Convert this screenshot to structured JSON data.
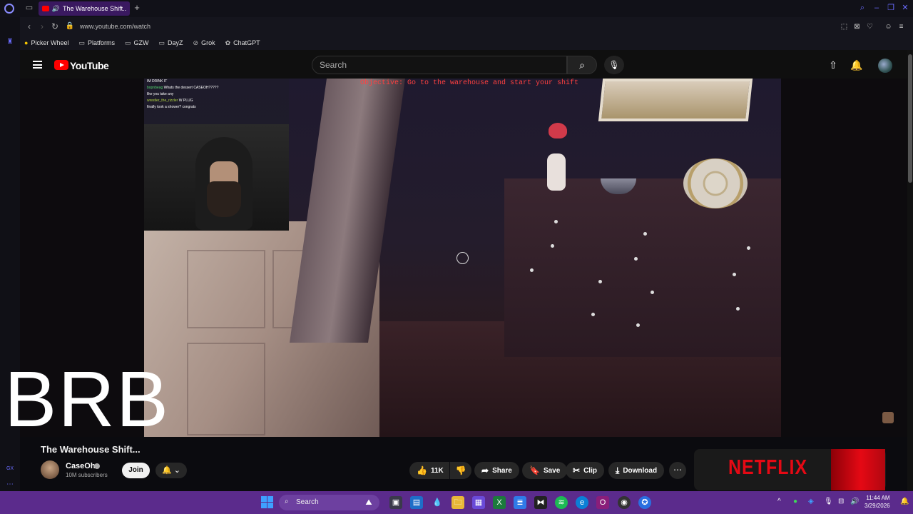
{
  "browser": {
    "tab_title": "The Warehouse Shift...",
    "url": "www.youtube.com/watch",
    "bookmarks": [
      {
        "label": "Picker Wheel",
        "icon": "wheel-icon"
      },
      {
        "label": "Platforms",
        "icon": "folder-icon"
      },
      {
        "label": "GZW",
        "icon": "folder-icon"
      },
      {
        "label": "DayZ",
        "icon": "folder-icon"
      },
      {
        "label": "Grok",
        "icon": "grok-icon"
      },
      {
        "label": "ChatGPT",
        "icon": "chatgpt-icon"
      }
    ],
    "sidebar_label": "GX"
  },
  "youtube": {
    "logo_text": "YouTube",
    "search_placeholder": "Search"
  },
  "video": {
    "objective_text": "Objective: Go to the warehouse and start your shift",
    "overlay_text": "BRB",
    "chat": [
      {
        "user": "",
        "msg": "IM DRINK IT"
      },
      {
        "user": "bopnbeag",
        "msg": "Whats the dessert CASEOH?????"
      },
      {
        "user": "",
        "msg": "like you take any"
      },
      {
        "user": "wrestler_the_rizzler",
        "msg": "W PLUG"
      },
      {
        "user": "",
        "msg": "finally took a shower? congrats"
      }
    ]
  },
  "video_info": {
    "title": "The Warehouse Shift...",
    "channel_name": "CaseOh",
    "subscribers": "10M subscribers",
    "join_label": "Join",
    "likes": "11K",
    "share_label": "Share",
    "save_label": "Save",
    "clip_label": "Clip",
    "download_label": "Download"
  },
  "ad": {
    "brand": "NETFLIX"
  },
  "taskbar": {
    "search_placeholder": "Search",
    "time": "11:44 AM",
    "date": "3/29/2026"
  },
  "colors": {
    "accent": "#5b2b8c",
    "youtube_red": "#ff0000",
    "netflix_red": "#e50914",
    "objective_red": "#ff4040"
  }
}
